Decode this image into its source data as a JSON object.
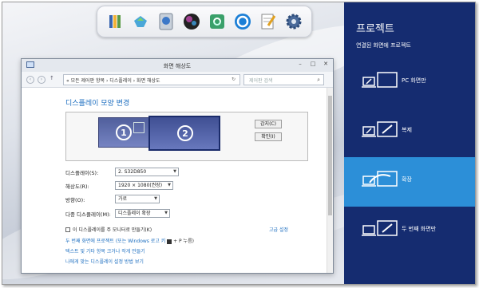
{
  "dock": {
    "icons": [
      "library-icon",
      "recycle-icon",
      "computer-icon",
      "media-ball-icon",
      "sync-icon",
      "circle-app-icon",
      "notepad-icon",
      "gear-icon"
    ]
  },
  "window": {
    "title": "화면 해상도",
    "address": "« 모든 제어판 항목 › 디스플레이 › 화면 해상도",
    "search_placeholder": "제어판 검색",
    "heading": "디스플레이 모양 변경",
    "monitor1_label": "1",
    "monitor2_label": "2",
    "detect_button": "감지(C)",
    "identify_button": "확인(I)",
    "fields": [
      {
        "label": "디스플레이(S):",
        "value": "2. S32D850"
      },
      {
        "label": "해상도(R):",
        "value": "1920 × 1080(권장)"
      },
      {
        "label": "방향(O):",
        "value": "가로"
      },
      {
        "label": "다중 디스플레이(M):",
        "value": "디스플레이 확장"
      }
    ],
    "main_display_checkbox": "이 디스플레이를 주 모니터로 만들기(K)",
    "advanced_link": "고급 설정",
    "projector_text": "두 번째 화면에 프로젝트 (또는 Windows 로고 키 ",
    "projector_text_suffix": " + P 누름)",
    "link_text_size": "텍스트 및 기타 항목 크거나 작게 만들기",
    "link_which_display": "나에게 맞는 디스플레이 설정 방법 보기"
  },
  "charm": {
    "title": "프로젝트",
    "subtitle": "연결된 화면에 프로젝트",
    "options": [
      {
        "label": "PC 화면만",
        "selected": false
      },
      {
        "label": "복제",
        "selected": false
      },
      {
        "label": "확장",
        "selected": true
      },
      {
        "label": "두 번째 화면만",
        "selected": false
      }
    ],
    "colors": {
      "panel": "#152c70",
      "selected": "#2c8fd8"
    }
  }
}
